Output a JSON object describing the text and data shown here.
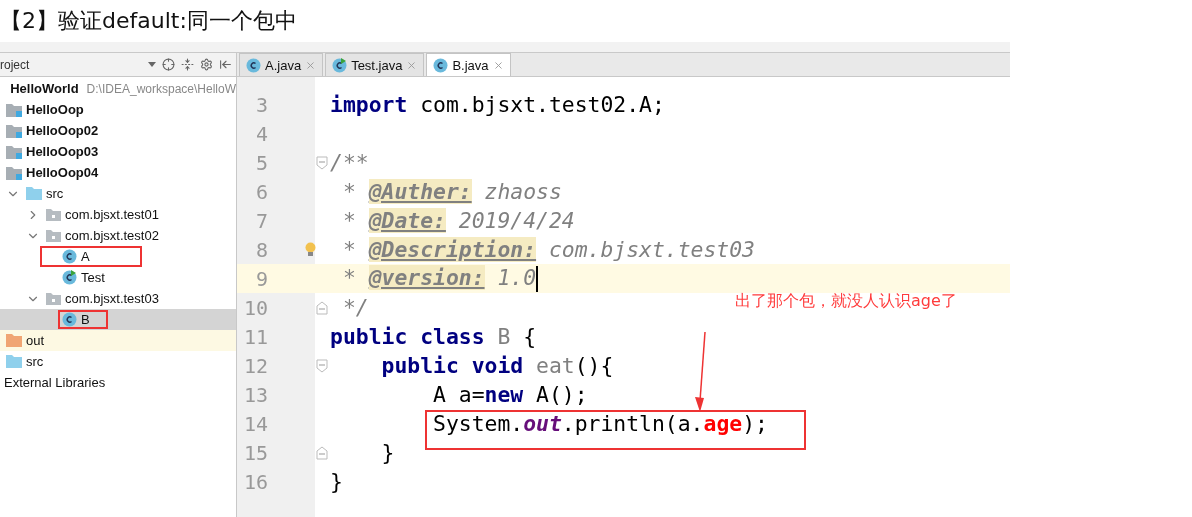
{
  "heading": "【2】验证default:同一个包中",
  "project_panel": {
    "title": "roject"
  },
  "tree": [
    {
      "label": "HelloWorld",
      "path": "D:\\IDEA_workspace\\HelloW",
      "kind": "module",
      "bold": true,
      "selected": false,
      "highlighted": false
    },
    {
      "label": "HelloOop",
      "kind": "module",
      "bold": true,
      "selected": false,
      "highlighted": false
    },
    {
      "label": "HelloOop02",
      "kind": "module",
      "bold": true,
      "selected": false,
      "highlighted": false
    },
    {
      "label": "HelloOop03",
      "kind": "module",
      "bold": true,
      "selected": false,
      "highlighted": false
    },
    {
      "label": "HelloOop04",
      "kind": "module",
      "bold": true,
      "selected": false,
      "highlighted": false
    },
    {
      "label": "src",
      "kind": "source",
      "bold": false,
      "selected": false,
      "highlighted": false,
      "expanded": true,
      "children": [
        {
          "label": "com.bjsxt.test01",
          "kind": "package",
          "bold": false,
          "selected": false,
          "highlighted": false,
          "expanded": false
        },
        {
          "label": "com.bjsxt.test02",
          "kind": "package",
          "bold": false,
          "selected": false,
          "highlighted": false,
          "expanded": true,
          "children": [
            {
              "label": "A",
              "kind": "class",
              "bold": false,
              "selected": false,
              "highlighted": true
            },
            {
              "label": "Test",
              "kind": "test-class",
              "bold": false,
              "selected": false,
              "highlighted": false
            }
          ]
        },
        {
          "label": "com.bjsxt.test03",
          "kind": "package",
          "bold": false,
          "selected": false,
          "highlighted": false,
          "expanded": true,
          "children": [
            {
              "label": "B",
              "kind": "class",
              "bold": false,
              "selected": true,
              "highlighted": true
            }
          ]
        }
      ]
    },
    {
      "label": "out",
      "kind": "excluded",
      "bold": false,
      "selected": false,
      "highlighted": false
    },
    {
      "label": "src",
      "kind": "source",
      "bold": false,
      "selected": false,
      "highlighted": false
    },
    {
      "label": "External Libraries",
      "kind": "library",
      "bold": false,
      "selected": false,
      "highlighted": false
    }
  ],
  "tabs": [
    {
      "label": "A.java",
      "kind": "class",
      "selected": false
    },
    {
      "label": "Test.java",
      "kind": "test-class",
      "selected": false
    },
    {
      "label": "B.java",
      "kind": "class",
      "selected": true
    }
  ],
  "code_lines": [
    {
      "number": "3",
      "current": false,
      "bulb": false,
      "boxed": false,
      "fold_start": false,
      "fold_end": false,
      "tokens": [
        {
          "kind": "keyword",
          "text": "import"
        },
        {
          "kind": "plain",
          "text": " com.bjsxt.test02.A;"
        }
      ]
    },
    {
      "number": "4",
      "current": false,
      "bulb": false,
      "boxed": false,
      "fold_start": false,
      "fold_end": false
    },
    {
      "number": "5",
      "current": false,
      "bulb": false,
      "boxed": false,
      "fold_start": true,
      "fold_end": false,
      "tokens": [
        {
          "kind": "comment",
          "text": "/**"
        }
      ]
    },
    {
      "number": "6",
      "current": false,
      "bulb": false,
      "boxed": false,
      "fold_start": false,
      "fold_end": false,
      "tokens": [
        {
          "kind": "comment",
          "text": " * "
        },
        {
          "kind": "doctag",
          "text": "@Auther:"
        },
        {
          "kind": "comment",
          "text": " zhaoss"
        }
      ]
    },
    {
      "number": "7",
      "current": false,
      "bulb": false,
      "boxed": false,
      "fold_start": false,
      "fold_end": false,
      "tokens": [
        {
          "kind": "comment",
          "text": " * "
        },
        {
          "kind": "doctag",
          "text": "@Date:"
        },
        {
          "kind": "comment",
          "text": " 2019/4/24"
        }
      ]
    },
    {
      "number": "8",
      "current": false,
      "bulb": true,
      "boxed": false,
      "fold_start": false,
      "fold_end": false,
      "tokens": [
        {
          "kind": "comment",
          "text": " * "
        },
        {
          "kind": "doctag",
          "text": "@Description:"
        },
        {
          "kind": "comment",
          "text": " com.bjsxt.test03"
        }
      ]
    },
    {
      "number": "9",
      "current": true,
      "bulb": false,
      "boxed": false,
      "fold_start": false,
      "fold_end": false,
      "tokens": [
        {
          "kind": "comment",
          "text": " * "
        },
        {
          "kind": "doctag",
          "text": "@version:"
        },
        {
          "kind": "comment",
          "text": " 1.0"
        }
      ]
    },
    {
      "number": "10",
      "current": false,
      "bulb": false,
      "boxed": false,
      "fold_start": false,
      "fold_end": true,
      "tokens": [
        {
          "kind": "comment",
          "text": " */"
        }
      ]
    },
    {
      "number": "11",
      "current": false,
      "bulb": false,
      "boxed": false,
      "fold_start": false,
      "fold_end": false,
      "tokens": [
        {
          "kind": "keyword",
          "text": "public class "
        },
        {
          "kind": "unused",
          "text": "B"
        },
        {
          "kind": "plain",
          "text": " {"
        }
      ]
    },
    {
      "number": "12",
      "current": false,
      "bulb": false,
      "boxed": false,
      "fold_start": true,
      "fold_end": false,
      "tokens": [
        {
          "kind": "keyword",
          "text": "    public void "
        },
        {
          "kind": "unused",
          "text": "eat"
        },
        {
          "kind": "plain",
          "text": "(){"
        }
      ]
    },
    {
      "number": "13",
      "current": false,
      "bulb": false,
      "boxed": false,
      "fold_start": false,
      "fold_end": false,
      "tokens": [
        {
          "kind": "plain",
          "text": "        A a="
        },
        {
          "kind": "keyword",
          "text": "new"
        },
        {
          "kind": "plain",
          "text": " A();"
        }
      ]
    },
    {
      "number": "14",
      "current": false,
      "bulb": false,
      "boxed": true,
      "fold_start": false,
      "fold_end": false,
      "tokens": [
        {
          "kind": "plain",
          "text": "        System."
        },
        {
          "kind": "static-field",
          "text": "out"
        },
        {
          "kind": "plain",
          "text": ".println(a."
        },
        {
          "kind": "error",
          "text": "age"
        },
        {
          "kind": "plain",
          "text": ");"
        }
      ]
    },
    {
      "number": "15",
      "current": false,
      "bulb": false,
      "boxed": false,
      "fold_start": false,
      "fold_end": true,
      "tokens": [
        {
          "kind": "plain",
          "text": "    }"
        }
      ]
    },
    {
      "number": "16",
      "current": false,
      "bulb": false,
      "boxed": false,
      "fold_start": false,
      "fold_end": false,
      "tokens": [
        {
          "kind": "plain",
          "text": "}"
        }
      ]
    }
  ],
  "annotation": {
    "text": "出了那个包，就没人认识age了"
  }
}
